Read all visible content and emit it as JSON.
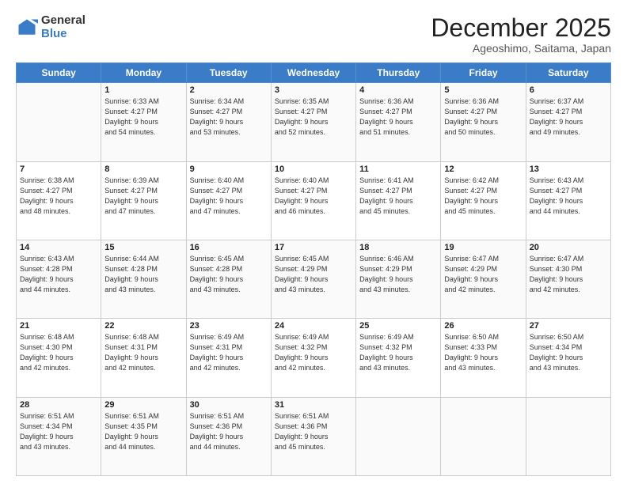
{
  "logo": {
    "general": "General",
    "blue": "Blue"
  },
  "header": {
    "month": "December 2025",
    "location": "Ageoshimo, Saitama, Japan"
  },
  "weekdays": [
    "Sunday",
    "Monday",
    "Tuesday",
    "Wednesday",
    "Thursday",
    "Friday",
    "Saturday"
  ],
  "weeks": [
    [
      {
        "day": "",
        "info": ""
      },
      {
        "day": "1",
        "info": "Sunrise: 6:33 AM\nSunset: 4:27 PM\nDaylight: 9 hours\nand 54 minutes."
      },
      {
        "day": "2",
        "info": "Sunrise: 6:34 AM\nSunset: 4:27 PM\nDaylight: 9 hours\nand 53 minutes."
      },
      {
        "day": "3",
        "info": "Sunrise: 6:35 AM\nSunset: 4:27 PM\nDaylight: 9 hours\nand 52 minutes."
      },
      {
        "day": "4",
        "info": "Sunrise: 6:36 AM\nSunset: 4:27 PM\nDaylight: 9 hours\nand 51 minutes."
      },
      {
        "day": "5",
        "info": "Sunrise: 6:36 AM\nSunset: 4:27 PM\nDaylight: 9 hours\nand 50 minutes."
      },
      {
        "day": "6",
        "info": "Sunrise: 6:37 AM\nSunset: 4:27 PM\nDaylight: 9 hours\nand 49 minutes."
      }
    ],
    [
      {
        "day": "7",
        "info": "Sunrise: 6:38 AM\nSunset: 4:27 PM\nDaylight: 9 hours\nand 48 minutes."
      },
      {
        "day": "8",
        "info": "Sunrise: 6:39 AM\nSunset: 4:27 PM\nDaylight: 9 hours\nand 47 minutes."
      },
      {
        "day": "9",
        "info": "Sunrise: 6:40 AM\nSunset: 4:27 PM\nDaylight: 9 hours\nand 47 minutes."
      },
      {
        "day": "10",
        "info": "Sunrise: 6:40 AM\nSunset: 4:27 PM\nDaylight: 9 hours\nand 46 minutes."
      },
      {
        "day": "11",
        "info": "Sunrise: 6:41 AM\nSunset: 4:27 PM\nDaylight: 9 hours\nand 45 minutes."
      },
      {
        "day": "12",
        "info": "Sunrise: 6:42 AM\nSunset: 4:27 PM\nDaylight: 9 hours\nand 45 minutes."
      },
      {
        "day": "13",
        "info": "Sunrise: 6:43 AM\nSunset: 4:27 PM\nDaylight: 9 hours\nand 44 minutes."
      }
    ],
    [
      {
        "day": "14",
        "info": "Sunrise: 6:43 AM\nSunset: 4:28 PM\nDaylight: 9 hours\nand 44 minutes."
      },
      {
        "day": "15",
        "info": "Sunrise: 6:44 AM\nSunset: 4:28 PM\nDaylight: 9 hours\nand 43 minutes."
      },
      {
        "day": "16",
        "info": "Sunrise: 6:45 AM\nSunset: 4:28 PM\nDaylight: 9 hours\nand 43 minutes."
      },
      {
        "day": "17",
        "info": "Sunrise: 6:45 AM\nSunset: 4:29 PM\nDaylight: 9 hours\nand 43 minutes."
      },
      {
        "day": "18",
        "info": "Sunrise: 6:46 AM\nSunset: 4:29 PM\nDaylight: 9 hours\nand 43 minutes."
      },
      {
        "day": "19",
        "info": "Sunrise: 6:47 AM\nSunset: 4:29 PM\nDaylight: 9 hours\nand 42 minutes."
      },
      {
        "day": "20",
        "info": "Sunrise: 6:47 AM\nSunset: 4:30 PM\nDaylight: 9 hours\nand 42 minutes."
      }
    ],
    [
      {
        "day": "21",
        "info": "Sunrise: 6:48 AM\nSunset: 4:30 PM\nDaylight: 9 hours\nand 42 minutes."
      },
      {
        "day": "22",
        "info": "Sunrise: 6:48 AM\nSunset: 4:31 PM\nDaylight: 9 hours\nand 42 minutes."
      },
      {
        "day": "23",
        "info": "Sunrise: 6:49 AM\nSunset: 4:31 PM\nDaylight: 9 hours\nand 42 minutes."
      },
      {
        "day": "24",
        "info": "Sunrise: 6:49 AM\nSunset: 4:32 PM\nDaylight: 9 hours\nand 42 minutes."
      },
      {
        "day": "25",
        "info": "Sunrise: 6:49 AM\nSunset: 4:32 PM\nDaylight: 9 hours\nand 43 minutes."
      },
      {
        "day": "26",
        "info": "Sunrise: 6:50 AM\nSunset: 4:33 PM\nDaylight: 9 hours\nand 43 minutes."
      },
      {
        "day": "27",
        "info": "Sunrise: 6:50 AM\nSunset: 4:34 PM\nDaylight: 9 hours\nand 43 minutes."
      }
    ],
    [
      {
        "day": "28",
        "info": "Sunrise: 6:51 AM\nSunset: 4:34 PM\nDaylight: 9 hours\nand 43 minutes."
      },
      {
        "day": "29",
        "info": "Sunrise: 6:51 AM\nSunset: 4:35 PM\nDaylight: 9 hours\nand 44 minutes."
      },
      {
        "day": "30",
        "info": "Sunrise: 6:51 AM\nSunset: 4:36 PM\nDaylight: 9 hours\nand 44 minutes."
      },
      {
        "day": "31",
        "info": "Sunrise: 6:51 AM\nSunset: 4:36 PM\nDaylight: 9 hours\nand 45 minutes."
      },
      {
        "day": "",
        "info": ""
      },
      {
        "day": "",
        "info": ""
      },
      {
        "day": "",
        "info": ""
      }
    ]
  ]
}
